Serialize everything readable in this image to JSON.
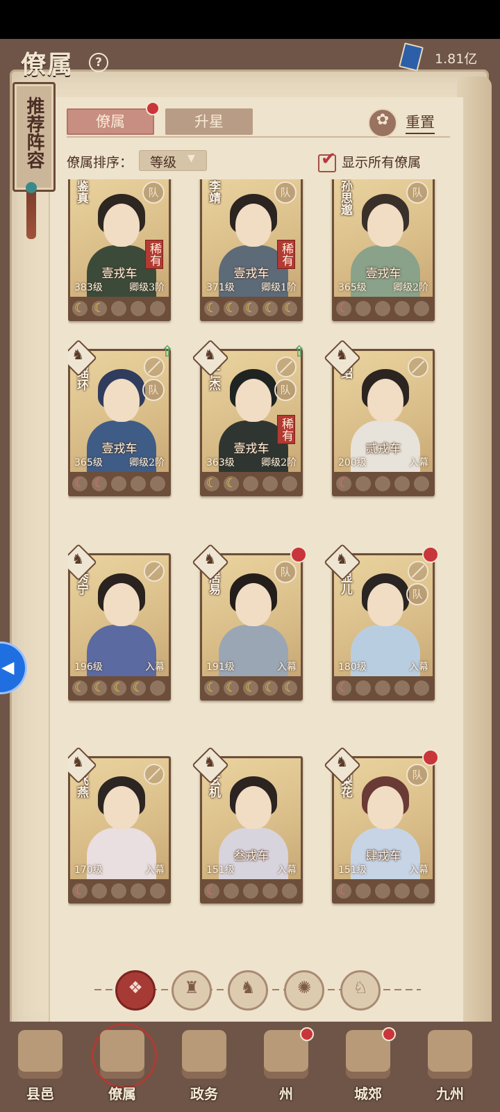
{
  "header": {
    "title": "僚属",
    "help_icon": "question-icon",
    "currency_icon": "book-icon",
    "currency_value": "1.81亿"
  },
  "recommend_tab": {
    "label": "推荐阵容"
  },
  "tabs": [
    {
      "label": "僚属",
      "active": true,
      "badge": true
    },
    {
      "label": "升星",
      "active": false
    }
  ],
  "reset": {
    "label": "重置",
    "icon": "reset-icon"
  },
  "sort": {
    "label": "僚属排序：",
    "value": "等级",
    "show_all_label": "显示所有僚属",
    "show_all_checked": true
  },
  "cards": [
    {
      "name": "鉴真",
      "rank": "壹戎车",
      "level": "383级",
      "grade": "卿级3阶",
      "rare": "稀有",
      "team": "队",
      "stars": [
        "gold",
        "gold",
        "empty",
        "empty",
        "empty"
      ],
      "hair": "#2e2620",
      "robe": "#3c4a3a"
    },
    {
      "name": "李靖",
      "rank": "壹戎车",
      "level": "371级",
      "grade": "卿级1阶",
      "rare": "稀有",
      "team": "队",
      "stars": [
        "gold",
        "gold",
        "gold",
        "gold",
        "gold"
      ],
      "hair": "#2b2420",
      "robe": "#5d6b78"
    },
    {
      "name": "孙思邈",
      "rank": "壹戎车",
      "level": "365级",
      "grade": "卿级2阶",
      "rare": "",
      "team": "队",
      "stars": [
        "red",
        "empty",
        "empty",
        "empty",
        "empty"
      ],
      "hair": "#3a302a",
      "robe": "#8aa28a"
    },
    {
      "name": "谢瑶环",
      "rank": "壹戎车",
      "level": "365级",
      "grade": "卿级2阶",
      "rare": "",
      "team": "队",
      "stars": [
        "red",
        "red",
        "empty",
        "empty",
        "empty"
      ],
      "hair": "#2f3c5e",
      "robe": "#3f5c86",
      "faction": true,
      "nohand": true,
      "uparrow": true
    },
    {
      "name": "狄仁杰",
      "rank": "壹戎车",
      "level": "363级",
      "grade": "卿级2阶",
      "rare": "稀有",
      "team": "队",
      "stars": [
        "gold",
        "gold",
        "empty",
        "empty",
        "empty"
      ],
      "hair": "#1f2422",
      "robe": "#2f3632",
      "faction": true,
      "nohand": true,
      "uparrow": true
    },
    {
      "name": "柴绍",
      "rank": "贰戎车",
      "level": "200级",
      "grade": "入幕",
      "rare": "",
      "team": "",
      "stars": [
        "red",
        "empty",
        "empty",
        "empty",
        "empty"
      ],
      "hair": "#2c2420",
      "robe": "#e7e2da",
      "faction": true,
      "nohand": true
    },
    {
      "name": "李秀宁",
      "rank": "",
      "level": "196级",
      "grade": "入幕",
      "rare": "",
      "team": "",
      "stars": [
        "gold",
        "gold",
        "gold",
        "gold",
        "empty"
      ],
      "hair": "#2a221e",
      "robe": "#5b6aa0",
      "faction": true,
      "nohand": true
    },
    {
      "name": "白居易",
      "rank": "",
      "level": "191级",
      "grade": "入幕",
      "rare": "",
      "team": "队",
      "stars": [
        "gold",
        "gold",
        "gold",
        "gold",
        "gold"
      ],
      "hair": "#241e1b",
      "robe": "#9aa6b4",
      "faction": true,
      "reddot": true
    },
    {
      "name": "苏显儿",
      "rank": "",
      "level": "180级",
      "grade": "入幕",
      "rare": "",
      "team": "队",
      "stars": [
        "red",
        "empty",
        "empty",
        "empty",
        "empty"
      ],
      "hair": "#2a2522",
      "robe": "#b9cde0",
      "faction": true,
      "nohand": true,
      "reddot": true
    },
    {
      "name": "赵飞燕",
      "rank": "",
      "level": "170级",
      "grade": "入幕",
      "rare": "",
      "team": "",
      "stars": [
        "red",
        "empty",
        "empty",
        "empty",
        "empty"
      ],
      "hair": "#2c2522",
      "robe": "#e9dee0",
      "faction": true,
      "nohand": true
    },
    {
      "name": "鱼玄机",
      "rank": "叁戎车",
      "level": "151级",
      "grade": "入幕",
      "rare": "",
      "team": "",
      "stars": [
        "red",
        "empty",
        "empty",
        "empty",
        "empty"
      ],
      "hair": "#2b2421",
      "robe": "#d8d4de",
      "faction": true
    },
    {
      "name": "樊梨花",
      "rank": "肆戎车",
      "level": "151级",
      "grade": "入幕",
      "rare": "",
      "team": "队",
      "stars": [
        "red",
        "empty",
        "empty",
        "empty",
        "empty"
      ],
      "hair": "#6a3a36",
      "robe": "#c6d4e6",
      "faction": true,
      "reddot": true
    }
  ],
  "filters": [
    {
      "icon": "all-icon",
      "glyph": "❖",
      "active": true
    },
    {
      "icon": "civil-faction-icon",
      "glyph": "♜",
      "active": false
    },
    {
      "icon": "horse-faction-icon",
      "glyph": "♞",
      "active": false
    },
    {
      "icon": "fan-faction-icon",
      "glyph": "✺",
      "active": false
    },
    {
      "icon": "mount-faction-icon",
      "glyph": "♘",
      "active": false
    }
  ],
  "nav": [
    {
      "label": "县邑",
      "icon": "town-icon",
      "badge": false,
      "active": false
    },
    {
      "label": "僚属",
      "icon": "retainers-icon",
      "badge": false,
      "active": true
    },
    {
      "label": "政务",
      "icon": "affairs-icon",
      "badge": false,
      "active": false
    },
    {
      "label": "州",
      "icon": "prefecture-icon",
      "badge": true,
      "active": false
    },
    {
      "label": "城郊",
      "icon": "suburb-icon",
      "badge": true,
      "active": false
    },
    {
      "label": "九州",
      "icon": "map-icon",
      "badge": false,
      "active": false
    }
  ],
  "colors": {
    "accent": "#b23a33",
    "parchment": "#eee3cd",
    "frame": "#6e5548"
  }
}
